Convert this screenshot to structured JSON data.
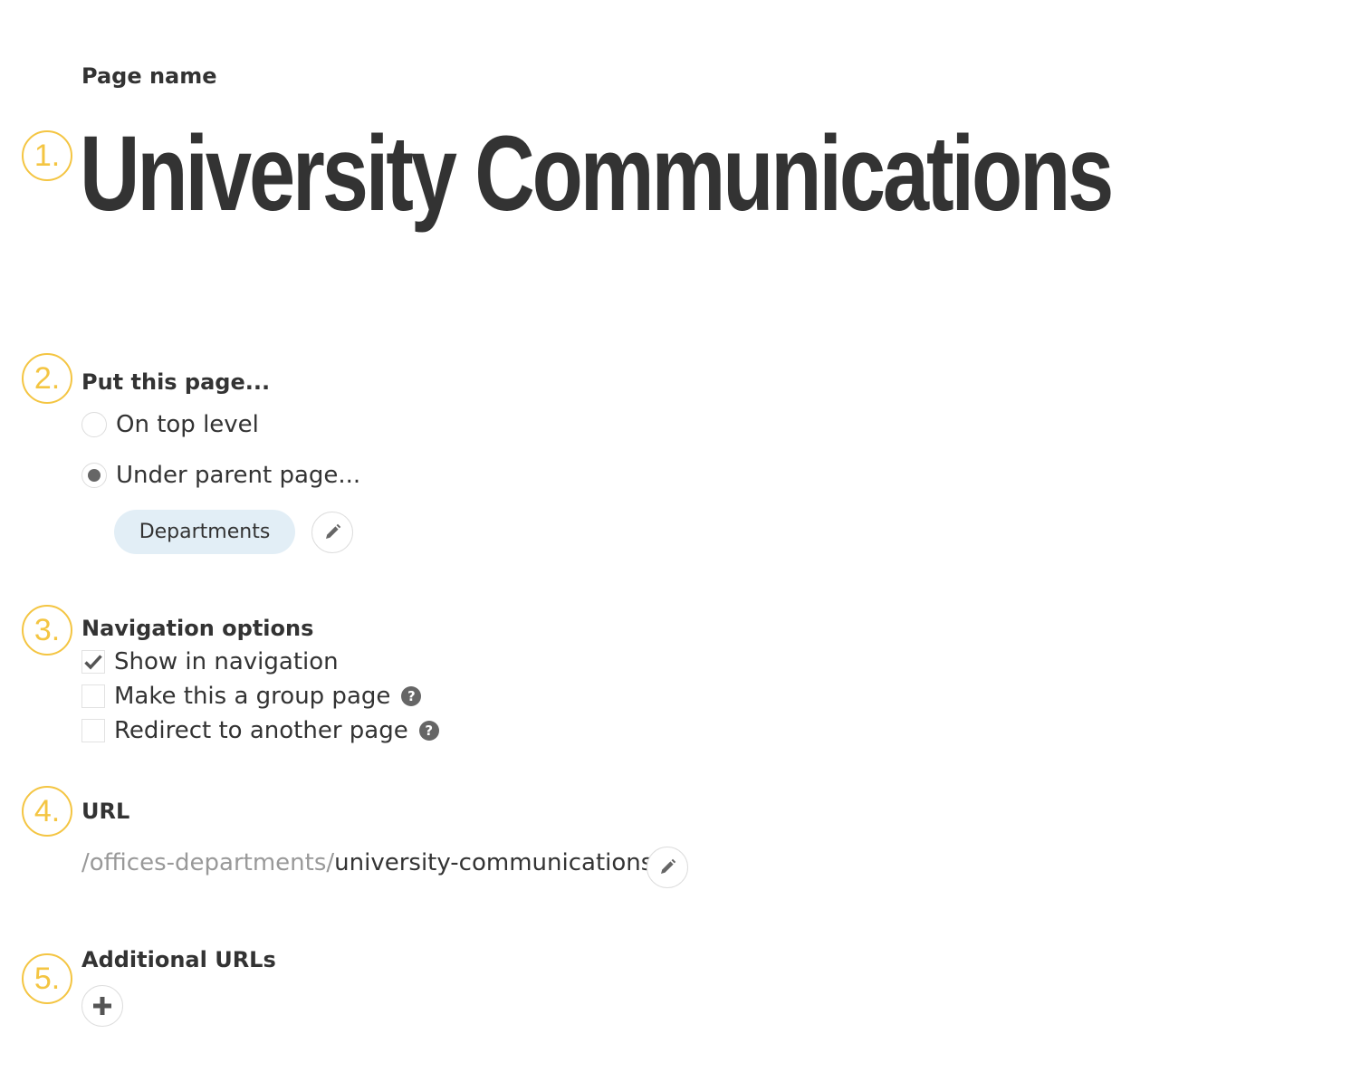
{
  "steps": [
    "1.",
    "2.",
    "3.",
    "4.",
    "5."
  ],
  "page_name": {
    "label": "Page name",
    "value": "University Communications"
  },
  "placement": {
    "label": "Put this page...",
    "options": [
      {
        "label": "On top level",
        "selected": false
      },
      {
        "label": "Under parent page...",
        "selected": true
      }
    ],
    "parent_page": "Departments"
  },
  "navigation": {
    "label": "Navigation options",
    "options": [
      {
        "label": "Show in navigation",
        "checked": true
      },
      {
        "label": "Make this a group page",
        "checked": false,
        "help": true
      },
      {
        "label": "Redirect to another page",
        "checked": false,
        "help": true
      }
    ]
  },
  "url": {
    "label": "URL",
    "prefix": "/offices-departments/",
    "slug": "university-communications"
  },
  "additional_urls": {
    "label": "Additional URLs"
  },
  "colors": {
    "step_marker": "#f4c542",
    "pill_bg": "#e2eef6",
    "text": "#333333",
    "muted": "#999999"
  },
  "icons": {
    "edit": "pencil-icon",
    "add": "plus-icon",
    "help": "question-circle-icon",
    "check": "checkmark-icon"
  }
}
